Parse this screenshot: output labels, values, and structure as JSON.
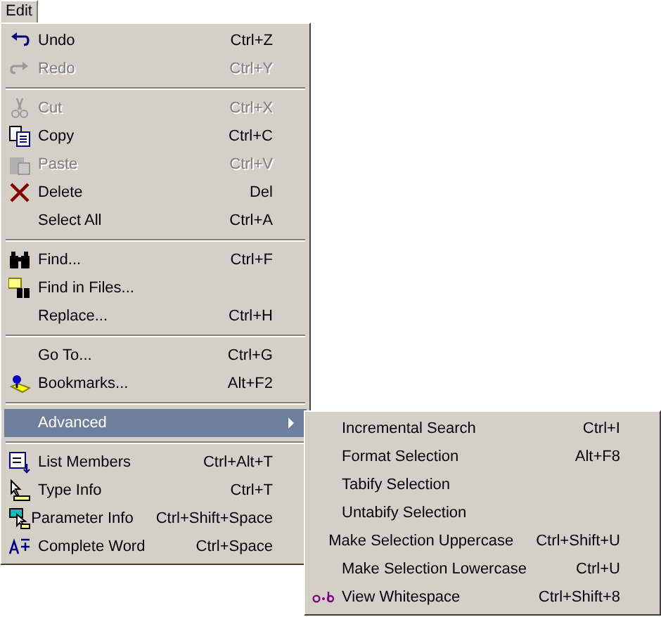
{
  "menubar": [
    {
      "label": "Edit",
      "selected": true
    }
  ],
  "menu": {
    "groups": [
      [
        {
          "label": "Undo",
          "shortcut": "Ctrl+Z",
          "disabled": false
        },
        {
          "label": "Redo",
          "shortcut": "Ctrl+Y",
          "disabled": true
        }
      ],
      [
        {
          "label": "Cut",
          "shortcut": "Ctrl+X",
          "disabled": true
        },
        {
          "label": "Copy",
          "shortcut": "Ctrl+C",
          "disabled": false
        },
        {
          "label": "Paste",
          "shortcut": "Ctrl+V",
          "disabled": true
        },
        {
          "label": "Delete",
          "shortcut": "Del",
          "disabled": false
        },
        {
          "label": "Select All",
          "shortcut": "Ctrl+A",
          "disabled": false
        }
      ],
      [
        {
          "label": "Find...",
          "shortcut": "Ctrl+F",
          "disabled": false
        },
        {
          "label": "Find in Files...",
          "disabled": false
        },
        {
          "label": "Replace...",
          "shortcut": "Ctrl+H",
          "disabled": false
        }
      ],
      [
        {
          "label": "Go To...",
          "shortcut": "Ctrl+G",
          "disabled": false
        },
        {
          "label": "Bookmarks...",
          "shortcut": "Alt+F2",
          "disabled": false
        }
      ],
      [
        {
          "label": "Advanced",
          "kind": "submenu",
          "selected": true,
          "disabled": false
        }
      ],
      [
        {
          "label": "List Members",
          "shortcut": "Ctrl+Alt+T",
          "disabled": false
        },
        {
          "label": "Type Info",
          "shortcut": "Ctrl+T",
          "disabled": false
        },
        {
          "label": "Parameter Info",
          "shortcut": "Ctrl+Shift+Space",
          "disabled": false
        },
        {
          "label": "Complete Word",
          "shortcut": "Ctrl+Space",
          "disabled": false
        }
      ]
    ]
  },
  "submenu": {
    "items": [
      {
        "label": "Incremental Search",
        "shortcut": "Ctrl+I"
      },
      {
        "label": "Format Selection",
        "shortcut": "Alt+F8"
      },
      {
        "label": "Tabify Selection"
      },
      {
        "label": "Untabify Selection"
      },
      {
        "label": "Make Selection Uppercase",
        "shortcut": "Ctrl+Shift+U"
      },
      {
        "label": "Make Selection Lowercase",
        "shortcut": "Ctrl+U"
      },
      {
        "label": "View Whitespace",
        "shortcut": "Ctrl+Shift+8"
      }
    ]
  }
}
